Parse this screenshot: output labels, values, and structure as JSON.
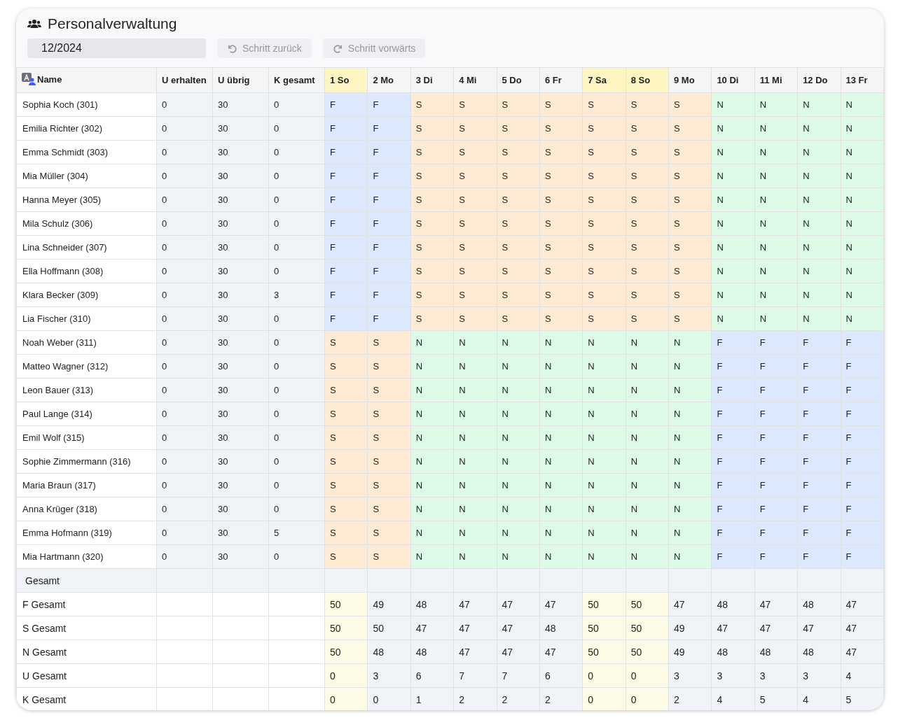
{
  "title": "Personalverwaltung",
  "month_field": {
    "value": "12/2024"
  },
  "toolbar": [
    {
      "label": "Schritt zurück",
      "kind": "undo",
      "disabled": true
    },
    {
      "label": "Schritt vorwärts",
      "kind": "redo",
      "disabled": true
    }
  ],
  "table": {
    "name_column": "Name",
    "stat_columns": [
      "U erhalten",
      "U übrig",
      "K gesamt"
    ],
    "days": [
      {
        "label": "1 So",
        "weekend": true
      },
      {
        "label": "2 Mo",
        "weekend": false
      },
      {
        "label": "3 Di",
        "weekend": false
      },
      {
        "label": "4 Mi",
        "weekend": false
      },
      {
        "label": "5 Do",
        "weekend": false
      },
      {
        "label": "6 Fr",
        "weekend": false
      },
      {
        "label": "7 Sa",
        "weekend": true
      },
      {
        "label": "8 So",
        "weekend": true
      },
      {
        "label": "9 Mo",
        "weekend": false
      },
      {
        "label": "10 Di",
        "weekend": false
      },
      {
        "label": "11 Mi",
        "weekend": false
      },
      {
        "label": "12 Do",
        "weekend": false
      },
      {
        "label": "13 Fr",
        "weekend": false
      }
    ],
    "rows": [
      {
        "name": "Sophia Koch (301)",
        "stats": [
          "0",
          "30",
          "0"
        ],
        "shifts": [
          {
            "text": "F",
            "kind": "early"
          },
          {
            "text": "F",
            "kind": "early"
          },
          {
            "text": "S",
            "kind": "late"
          },
          {
            "text": "S",
            "kind": "late"
          },
          {
            "text": "S",
            "kind": "late"
          },
          {
            "text": "S",
            "kind": "late"
          },
          {
            "text": "S",
            "kind": "late"
          },
          {
            "text": "S",
            "kind": "late"
          },
          {
            "text": "S",
            "kind": "late"
          },
          {
            "text": "N",
            "kind": "night"
          },
          {
            "text": "N",
            "kind": "night"
          },
          {
            "text": "N",
            "kind": "night"
          },
          {
            "text": "N",
            "kind": "night"
          }
        ]
      },
      {
        "name": "Emilia Richter (302)",
        "stats": [
          "0",
          "30",
          "0"
        ],
        "shifts": [
          {
            "text": "F",
            "kind": "early"
          },
          {
            "text": "F",
            "kind": "early"
          },
          {
            "text": "S",
            "kind": "late"
          },
          {
            "text": "S",
            "kind": "late"
          },
          {
            "text": "S",
            "kind": "late"
          },
          {
            "text": "S",
            "kind": "late"
          },
          {
            "text": "S",
            "kind": "late"
          },
          {
            "text": "S",
            "kind": "late"
          },
          {
            "text": "S",
            "kind": "late"
          },
          {
            "text": "N",
            "kind": "night"
          },
          {
            "text": "N",
            "kind": "night"
          },
          {
            "text": "N",
            "kind": "night"
          },
          {
            "text": "N",
            "kind": "night"
          }
        ]
      },
      {
        "name": "Emma Schmidt (303)",
        "stats": [
          "0",
          "30",
          "0"
        ],
        "shifts": [
          {
            "text": "F",
            "kind": "early"
          },
          {
            "text": "F",
            "kind": "early"
          },
          {
            "text": "S",
            "kind": "late"
          },
          {
            "text": "S",
            "kind": "late"
          },
          {
            "text": "S",
            "kind": "late"
          },
          {
            "text": "S",
            "kind": "late"
          },
          {
            "text": "S",
            "kind": "late"
          },
          {
            "text": "S",
            "kind": "late"
          },
          {
            "text": "S",
            "kind": "late"
          },
          {
            "text": "N",
            "kind": "night"
          },
          {
            "text": "N",
            "kind": "night"
          },
          {
            "text": "N",
            "kind": "night"
          },
          {
            "text": "N",
            "kind": "night"
          }
        ]
      },
      {
        "name": "Mia Müller (304)",
        "stats": [
          "0",
          "30",
          "0"
        ],
        "shifts": [
          {
            "text": "F",
            "kind": "early"
          },
          {
            "text": "F",
            "kind": "early"
          },
          {
            "text": "S",
            "kind": "late"
          },
          {
            "text": "S",
            "kind": "late"
          },
          {
            "text": "S",
            "kind": "late"
          },
          {
            "text": "S",
            "kind": "late"
          },
          {
            "text": "S",
            "kind": "late"
          },
          {
            "text": "S",
            "kind": "late"
          },
          {
            "text": "S",
            "kind": "late"
          },
          {
            "text": "N",
            "kind": "night"
          },
          {
            "text": "N",
            "kind": "night"
          },
          {
            "text": "N",
            "kind": "night"
          },
          {
            "text": "N",
            "kind": "night"
          }
        ]
      },
      {
        "name": "Hanna Meyer (305)",
        "stats": [
          "0",
          "30",
          "0"
        ],
        "shifts": [
          {
            "text": "F",
            "kind": "early"
          },
          {
            "text": "F",
            "kind": "early"
          },
          {
            "text": "S",
            "kind": "late"
          },
          {
            "text": "S",
            "kind": "late"
          },
          {
            "text": "S",
            "kind": "late"
          },
          {
            "text": "S",
            "kind": "late"
          },
          {
            "text": "S",
            "kind": "late"
          },
          {
            "text": "S",
            "kind": "late"
          },
          {
            "text": "S",
            "kind": "late"
          },
          {
            "text": "N",
            "kind": "night"
          },
          {
            "text": "N",
            "kind": "night"
          },
          {
            "text": "N",
            "kind": "night"
          },
          {
            "text": "N",
            "kind": "night"
          }
        ]
      },
      {
        "name": "Mila Schulz (306)",
        "stats": [
          "0",
          "30",
          "0"
        ],
        "shifts": [
          {
            "text": "F",
            "kind": "early"
          },
          {
            "text": "F",
            "kind": "early"
          },
          {
            "text": "S",
            "kind": "late"
          },
          {
            "text": "S",
            "kind": "late"
          },
          {
            "text": "S",
            "kind": "late"
          },
          {
            "text": "S",
            "kind": "late"
          },
          {
            "text": "S",
            "kind": "late"
          },
          {
            "text": "S",
            "kind": "late"
          },
          {
            "text": "S",
            "kind": "late"
          },
          {
            "text": "N",
            "kind": "night"
          },
          {
            "text": "N",
            "kind": "night"
          },
          {
            "text": "N",
            "kind": "night"
          },
          {
            "text": "N",
            "kind": "night"
          }
        ]
      },
      {
        "name": "Lina Schneider (307)",
        "stats": [
          "0",
          "30",
          "0"
        ],
        "shifts": [
          {
            "text": "F",
            "kind": "early"
          },
          {
            "text": "F",
            "kind": "early"
          },
          {
            "text": "S",
            "kind": "late"
          },
          {
            "text": "S",
            "kind": "late"
          },
          {
            "text": "S",
            "kind": "late"
          },
          {
            "text": "S",
            "kind": "late"
          },
          {
            "text": "S",
            "kind": "late"
          },
          {
            "text": "S",
            "kind": "late"
          },
          {
            "text": "S",
            "kind": "late"
          },
          {
            "text": "N",
            "kind": "night"
          },
          {
            "text": "N",
            "kind": "night"
          },
          {
            "text": "N",
            "kind": "night"
          },
          {
            "text": "N",
            "kind": "night"
          }
        ]
      },
      {
        "name": "Ella Hoffmann (308)",
        "stats": [
          "0",
          "30",
          "0"
        ],
        "shifts": [
          {
            "text": "F",
            "kind": "early"
          },
          {
            "text": "F",
            "kind": "early"
          },
          {
            "text": "S",
            "kind": "late"
          },
          {
            "text": "S",
            "kind": "late"
          },
          {
            "text": "S",
            "kind": "late"
          },
          {
            "text": "S",
            "kind": "late"
          },
          {
            "text": "S",
            "kind": "late"
          },
          {
            "text": "S",
            "kind": "late"
          },
          {
            "text": "S",
            "kind": "late"
          },
          {
            "text": "N",
            "kind": "night"
          },
          {
            "text": "N",
            "kind": "night"
          },
          {
            "text": "N",
            "kind": "night"
          },
          {
            "text": "N",
            "kind": "night"
          }
        ]
      },
      {
        "name": "Klara Becker (309)",
        "stats": [
          "0",
          "30",
          "3"
        ],
        "shifts": [
          {
            "text": "F",
            "kind": "early"
          },
          {
            "text": "F",
            "kind": "early"
          },
          {
            "text": "S",
            "kind": "late"
          },
          {
            "text": "S",
            "kind": "late"
          },
          {
            "text": "S",
            "kind": "late"
          },
          {
            "text": "S",
            "kind": "late"
          },
          {
            "text": "S",
            "kind": "late"
          },
          {
            "text": "S",
            "kind": "late"
          },
          {
            "text": "S",
            "kind": "late"
          },
          {
            "text": "N",
            "kind": "night"
          },
          {
            "text": "N",
            "kind": "night"
          },
          {
            "text": "N",
            "kind": "night"
          },
          {
            "text": "N",
            "kind": "night"
          }
        ]
      },
      {
        "name": "Lia Fischer (310)",
        "stats": [
          "0",
          "30",
          "0"
        ],
        "shifts": [
          {
            "text": "F",
            "kind": "early"
          },
          {
            "text": "F",
            "kind": "early"
          },
          {
            "text": "S",
            "kind": "late"
          },
          {
            "text": "S",
            "kind": "late"
          },
          {
            "text": "S",
            "kind": "late"
          },
          {
            "text": "S",
            "kind": "late"
          },
          {
            "text": "S",
            "kind": "late"
          },
          {
            "text": "S",
            "kind": "late"
          },
          {
            "text": "S",
            "kind": "late"
          },
          {
            "text": "N",
            "kind": "night"
          },
          {
            "text": "N",
            "kind": "night"
          },
          {
            "text": "N",
            "kind": "night"
          },
          {
            "text": "N",
            "kind": "night"
          }
        ]
      },
      {
        "name": "Noah Weber (311)",
        "stats": [
          "0",
          "30",
          "0"
        ],
        "shifts": [
          {
            "text": "S",
            "kind": "late"
          },
          {
            "text": "S",
            "kind": "late"
          },
          {
            "text": "N",
            "kind": "night"
          },
          {
            "text": "N",
            "kind": "night"
          },
          {
            "text": "N",
            "kind": "night"
          },
          {
            "text": "N",
            "kind": "night"
          },
          {
            "text": "N",
            "kind": "night"
          },
          {
            "text": "N",
            "kind": "night"
          },
          {
            "text": "N",
            "kind": "night"
          },
          {
            "text": "F",
            "kind": "early"
          },
          {
            "text": "F",
            "kind": "early"
          },
          {
            "text": "F",
            "kind": "early"
          },
          {
            "text": "F",
            "kind": "early"
          }
        ]
      },
      {
        "name": "Matteo Wagner (312)",
        "stats": [
          "0",
          "30",
          "0"
        ],
        "shifts": [
          {
            "text": "S",
            "kind": "late"
          },
          {
            "text": "S",
            "kind": "late"
          },
          {
            "text": "N",
            "kind": "night"
          },
          {
            "text": "N",
            "kind": "night"
          },
          {
            "text": "N",
            "kind": "night"
          },
          {
            "text": "N",
            "kind": "night"
          },
          {
            "text": "N",
            "kind": "night"
          },
          {
            "text": "N",
            "kind": "night"
          },
          {
            "text": "N",
            "kind": "night"
          },
          {
            "text": "F",
            "kind": "early"
          },
          {
            "text": "F",
            "kind": "early"
          },
          {
            "text": "F",
            "kind": "early"
          },
          {
            "text": "F",
            "kind": "early"
          }
        ]
      },
      {
        "name": "Leon Bauer (313)",
        "stats": [
          "0",
          "30",
          "0"
        ],
        "shifts": [
          {
            "text": "S",
            "kind": "late"
          },
          {
            "text": "S",
            "kind": "late"
          },
          {
            "text": "N",
            "kind": "night"
          },
          {
            "text": "N",
            "kind": "night"
          },
          {
            "text": "N",
            "kind": "night"
          },
          {
            "text": "N",
            "kind": "night"
          },
          {
            "text": "N",
            "kind": "night"
          },
          {
            "text": "N",
            "kind": "night"
          },
          {
            "text": "N",
            "kind": "night"
          },
          {
            "text": "F",
            "kind": "early"
          },
          {
            "text": "F",
            "kind": "early"
          },
          {
            "text": "F",
            "kind": "early"
          },
          {
            "text": "F",
            "kind": "early"
          }
        ]
      },
      {
        "name": "Paul Lange (314)",
        "stats": [
          "0",
          "30",
          "0"
        ],
        "shifts": [
          {
            "text": "S",
            "kind": "late"
          },
          {
            "text": "S",
            "kind": "late"
          },
          {
            "text": "N",
            "kind": "night"
          },
          {
            "text": "N",
            "kind": "night"
          },
          {
            "text": "N",
            "kind": "night"
          },
          {
            "text": "N",
            "kind": "night"
          },
          {
            "text": "N",
            "kind": "night"
          },
          {
            "text": "N",
            "kind": "night"
          },
          {
            "text": "N",
            "kind": "night"
          },
          {
            "text": "F",
            "kind": "early"
          },
          {
            "text": "F",
            "kind": "early"
          },
          {
            "text": "F",
            "kind": "early"
          },
          {
            "text": "F",
            "kind": "early"
          }
        ]
      },
      {
        "name": "Emil Wolf (315)",
        "stats": [
          "0",
          "30",
          "0"
        ],
        "shifts": [
          {
            "text": "S",
            "kind": "late"
          },
          {
            "text": "S",
            "kind": "late"
          },
          {
            "text": "N",
            "kind": "night"
          },
          {
            "text": "N",
            "kind": "night"
          },
          {
            "text": "N",
            "kind": "night"
          },
          {
            "text": "N",
            "kind": "night"
          },
          {
            "text": "N",
            "kind": "night"
          },
          {
            "text": "N",
            "kind": "night"
          },
          {
            "text": "N",
            "kind": "night"
          },
          {
            "text": "F",
            "kind": "early"
          },
          {
            "text": "F",
            "kind": "early"
          },
          {
            "text": "F",
            "kind": "early"
          },
          {
            "text": "F",
            "kind": "early"
          }
        ]
      },
      {
        "name": "Sophie Zimmermann (316)",
        "stats": [
          "0",
          "30",
          "0"
        ],
        "shifts": [
          {
            "text": "S",
            "kind": "late"
          },
          {
            "text": "S",
            "kind": "late"
          },
          {
            "text": "N",
            "kind": "night"
          },
          {
            "text": "N",
            "kind": "night"
          },
          {
            "text": "N",
            "kind": "night"
          },
          {
            "text": "N",
            "kind": "night"
          },
          {
            "text": "N",
            "kind": "night"
          },
          {
            "text": "N",
            "kind": "night"
          },
          {
            "text": "N",
            "kind": "night"
          },
          {
            "text": "F",
            "kind": "early"
          },
          {
            "text": "F",
            "kind": "early"
          },
          {
            "text": "F",
            "kind": "early"
          },
          {
            "text": "F",
            "kind": "early"
          }
        ]
      },
      {
        "name": "Maria Braun (317)",
        "stats": [
          "0",
          "30",
          "0"
        ],
        "shifts": [
          {
            "text": "S",
            "kind": "late"
          },
          {
            "text": "S",
            "kind": "late"
          },
          {
            "text": "N",
            "kind": "night"
          },
          {
            "text": "N",
            "kind": "night"
          },
          {
            "text": "N",
            "kind": "night"
          },
          {
            "text": "N",
            "kind": "night"
          },
          {
            "text": "N",
            "kind": "night"
          },
          {
            "text": "N",
            "kind": "night"
          },
          {
            "text": "N",
            "kind": "night"
          },
          {
            "text": "F",
            "kind": "early"
          },
          {
            "text": "F",
            "kind": "early"
          },
          {
            "text": "F",
            "kind": "early"
          },
          {
            "text": "F",
            "kind": "early"
          }
        ]
      },
      {
        "name": "Anna Krüger (318)",
        "stats": [
          "0",
          "30",
          "0"
        ],
        "shifts": [
          {
            "text": "S",
            "kind": "late"
          },
          {
            "text": "S",
            "kind": "late"
          },
          {
            "text": "N",
            "kind": "night"
          },
          {
            "text": "N",
            "kind": "night"
          },
          {
            "text": "N",
            "kind": "night"
          },
          {
            "text": "N",
            "kind": "night"
          },
          {
            "text": "N",
            "kind": "night"
          },
          {
            "text": "N",
            "kind": "night"
          },
          {
            "text": "N",
            "kind": "night"
          },
          {
            "text": "F",
            "kind": "early"
          },
          {
            "text": "F",
            "kind": "early"
          },
          {
            "text": "F",
            "kind": "early"
          },
          {
            "text": "F",
            "kind": "early"
          }
        ]
      },
      {
        "name": "Emma Hofmann (319)",
        "stats": [
          "0",
          "30",
          "5"
        ],
        "shifts": [
          {
            "text": "S",
            "kind": "late"
          },
          {
            "text": "S",
            "kind": "late"
          },
          {
            "text": "N",
            "kind": "night"
          },
          {
            "text": "N",
            "kind": "night"
          },
          {
            "text": "N",
            "kind": "night"
          },
          {
            "text": "N",
            "kind": "night"
          },
          {
            "text": "N",
            "kind": "night"
          },
          {
            "text": "N",
            "kind": "night"
          },
          {
            "text": "N",
            "kind": "night"
          },
          {
            "text": "F",
            "kind": "early"
          },
          {
            "text": "F",
            "kind": "early"
          },
          {
            "text": "F",
            "kind": "early"
          },
          {
            "text": "F",
            "kind": "early"
          }
        ]
      },
      {
        "name": "Mia Hartmann (320)",
        "stats": [
          "0",
          "30",
          "0"
        ],
        "shifts": [
          {
            "text": "S",
            "kind": "late"
          },
          {
            "text": "S",
            "kind": "late"
          },
          {
            "text": "N",
            "kind": "night"
          },
          {
            "text": "N",
            "kind": "night"
          },
          {
            "text": "N",
            "kind": "night"
          },
          {
            "text": "N",
            "kind": "night"
          },
          {
            "text": "N",
            "kind": "night"
          },
          {
            "text": "N",
            "kind": "night"
          },
          {
            "text": "N",
            "kind": "night"
          },
          {
            "text": "F",
            "kind": "early"
          },
          {
            "text": "F",
            "kind": "early"
          },
          {
            "text": "F",
            "kind": "early"
          },
          {
            "text": "F",
            "kind": "early"
          }
        ]
      }
    ],
    "totals_heading": "Gesamt",
    "totals": [
      {
        "label": "F Gesamt",
        "values": [
          "50",
          "49",
          "48",
          "47",
          "47",
          "47",
          "50",
          "50",
          "47",
          "48",
          "47",
          "48",
          "47"
        ]
      },
      {
        "label": "S Gesamt",
        "values": [
          "50",
          "50",
          "47",
          "47",
          "47",
          "48",
          "50",
          "50",
          "49",
          "47",
          "47",
          "47",
          "47"
        ]
      },
      {
        "label": "N Gesamt",
        "values": [
          "50",
          "48",
          "48",
          "47",
          "47",
          "47",
          "50",
          "50",
          "49",
          "48",
          "48",
          "48",
          "47"
        ]
      },
      {
        "label": "U Gesamt",
        "values": [
          "0",
          "3",
          "6",
          "7",
          "7",
          "6",
          "0",
          "0",
          "3",
          "3",
          "3",
          "3",
          "4"
        ]
      },
      {
        "label": "K Gesamt",
        "values": [
          "0",
          "0",
          "1",
          "2",
          "2",
          "2",
          "0",
          "0",
          "2",
          "4",
          "5",
          "4",
          "5"
        ]
      }
    ]
  }
}
